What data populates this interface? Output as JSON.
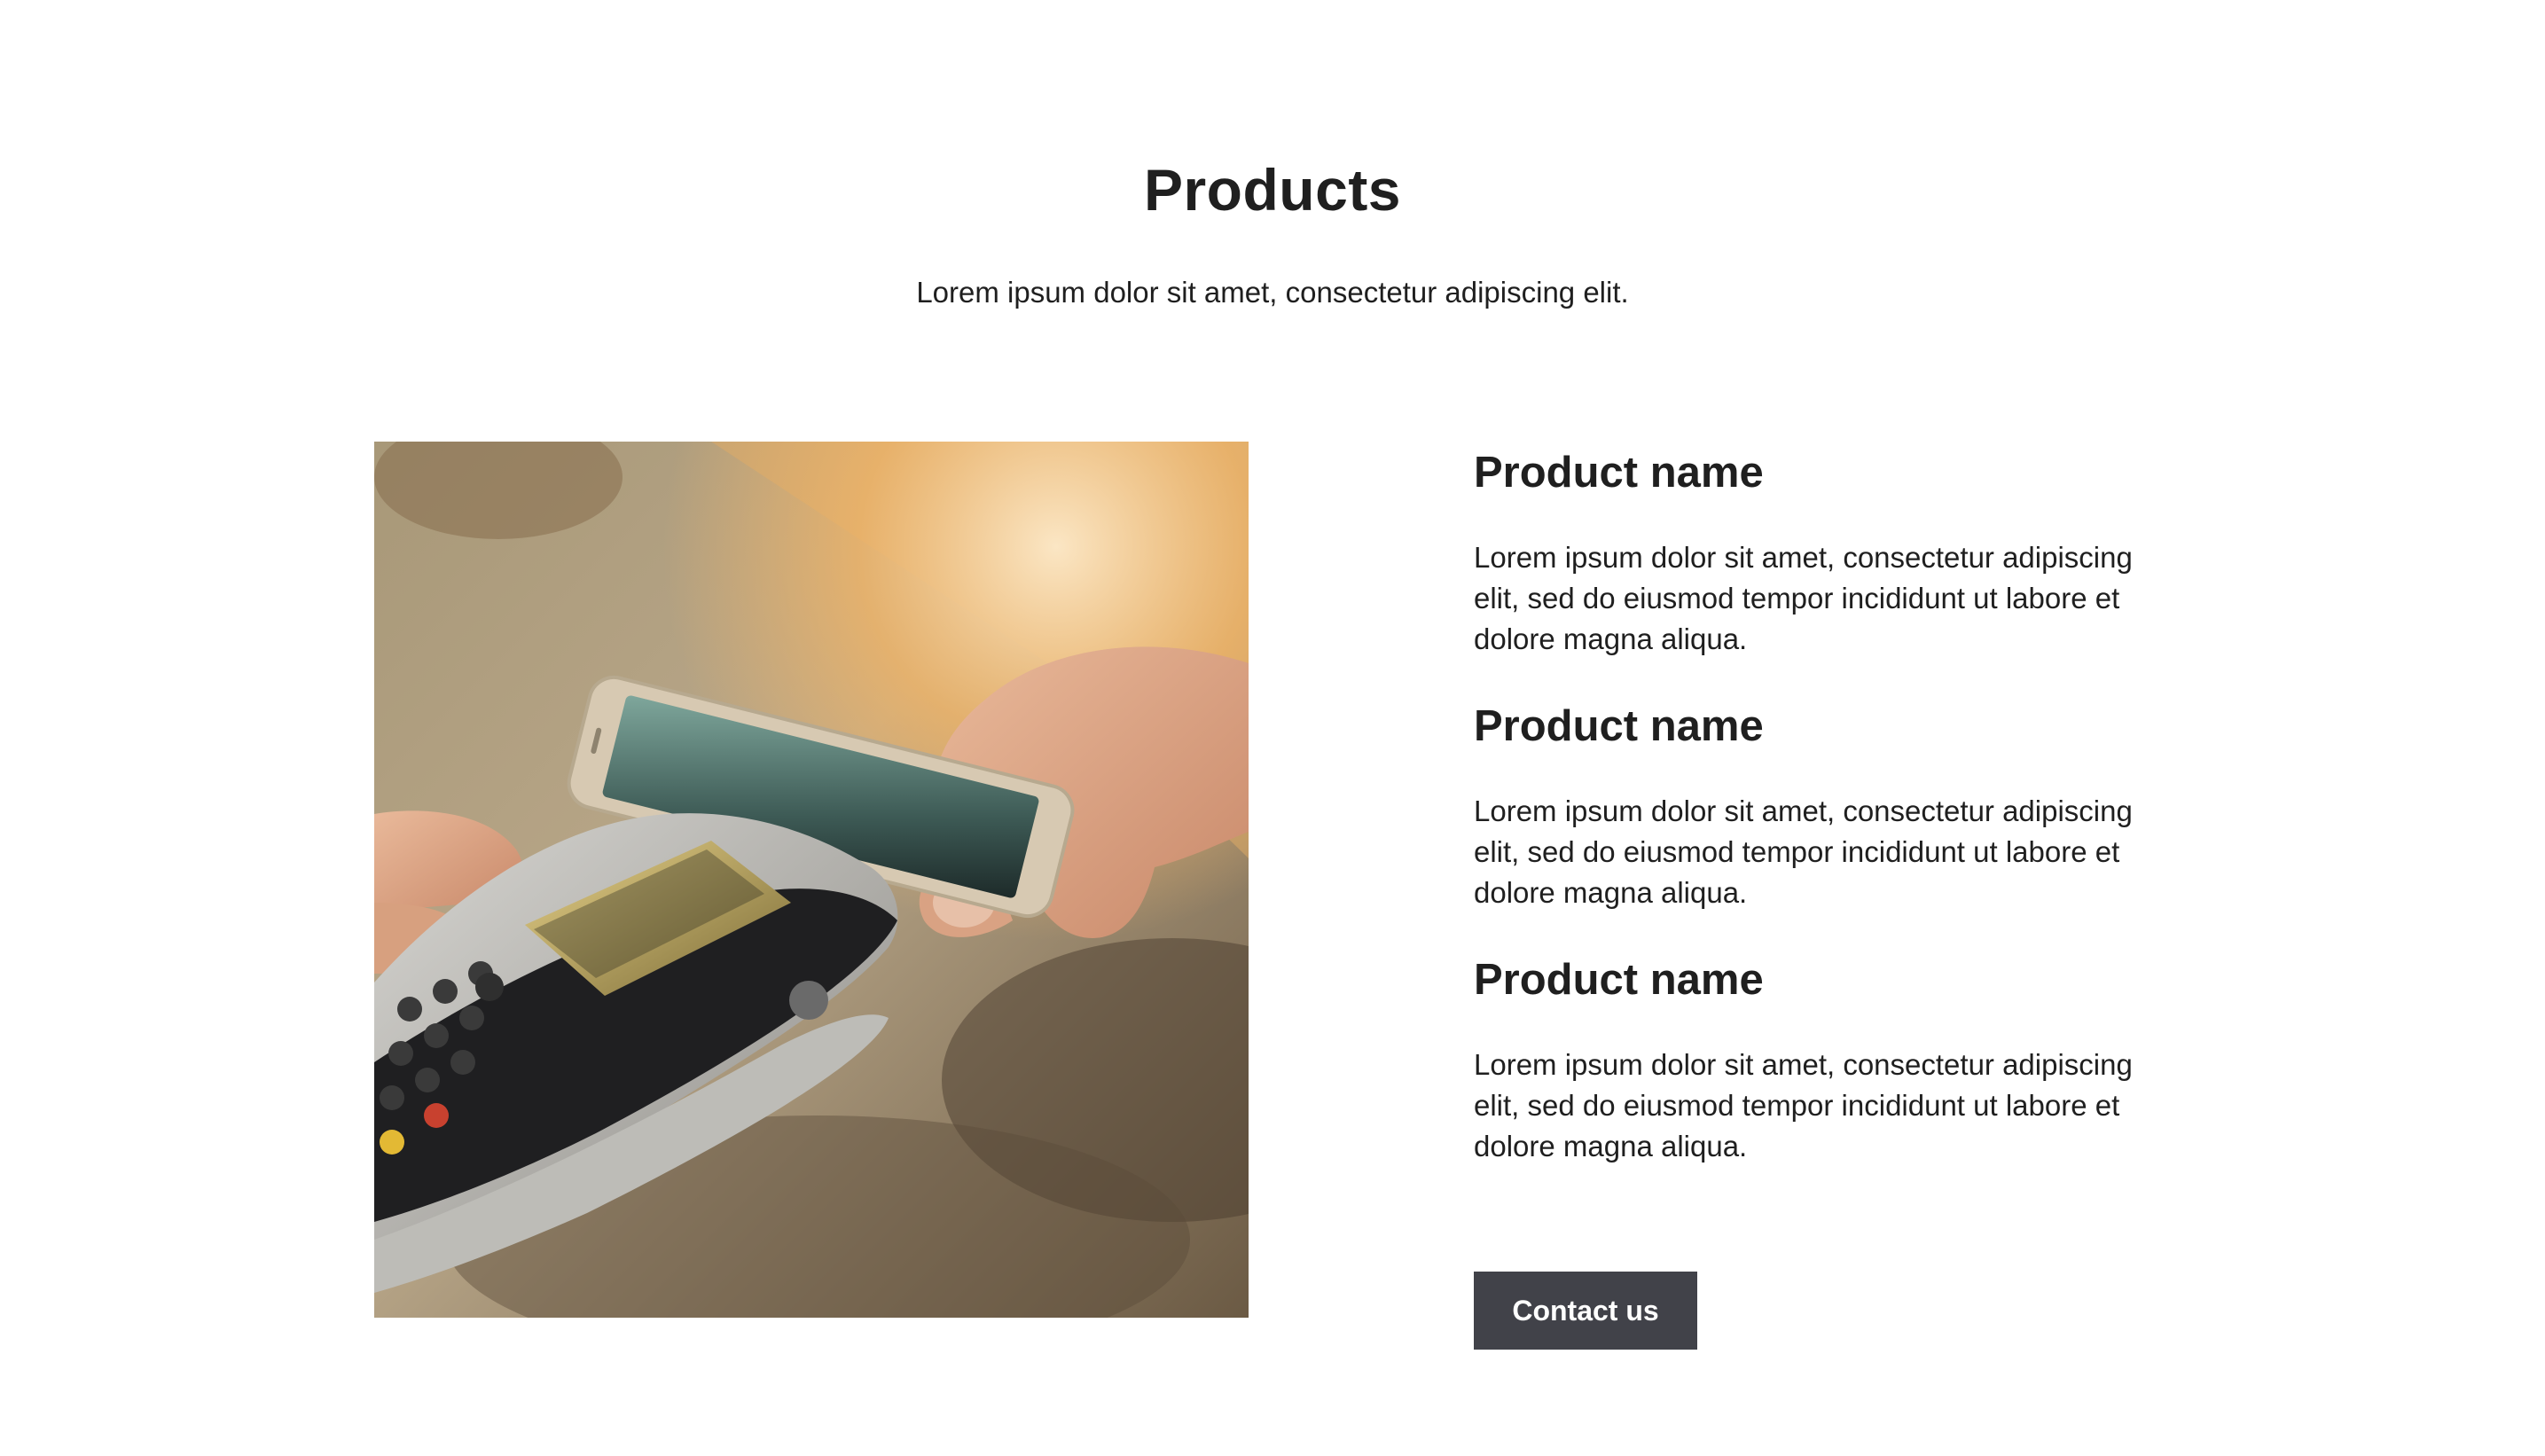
{
  "header": {
    "title": "Products",
    "subtitle": "Lorem ipsum dolor sit amet, consectetur adipiscing elit."
  },
  "products": [
    {
      "name": "Product name",
      "description": "Lorem ipsum dolor sit amet, consectetur adipiscing elit, sed do eiusmod tempor incididunt ut labore et dolore magna aliqua."
    },
    {
      "name": "Product name",
      "description": "Lorem ipsum dolor sit amet, consectetur adipiscing elit, sed do eiusmod tempor incididunt ut labore et dolore magna aliqua."
    },
    {
      "name": "Product name",
      "description": "Lorem ipsum dolor sit amet, consectetur adipiscing elit, sed do eiusmod tempor incididunt ut labore et dolore magna aliqua."
    }
  ],
  "cta": {
    "label": "Contact us"
  },
  "colors": {
    "button_bg": "#414249",
    "button_text": "#ffffff",
    "text": "#1f1f1f"
  }
}
